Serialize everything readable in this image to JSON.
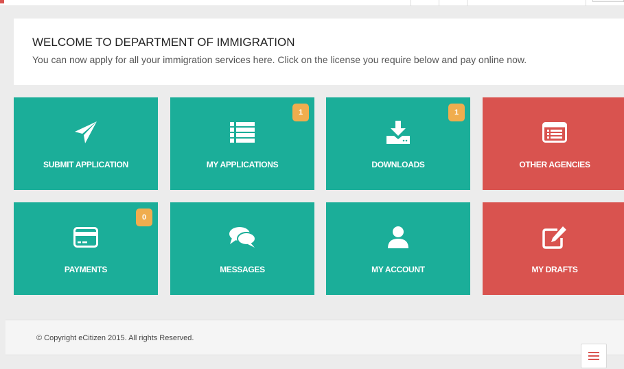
{
  "welcome": {
    "title": "WELCOME TO DEPARTMENT OF IMMIGRATION",
    "subtitle": "You can now apply for all your immigration services here. Click on the license you require below and pay online now."
  },
  "tiles": [
    {
      "label": "SUBMIT APPLICATION",
      "icon": "paper-plane-icon",
      "color": "#1bae99"
    },
    {
      "label": "MY APPLICATIONS",
      "icon": "list-icon",
      "color": "#1bae99",
      "badge": "1"
    },
    {
      "label": "DOWNLOADS",
      "icon": "download-icon",
      "color": "#1bae99",
      "badge": "1"
    },
    {
      "label": "OTHER AGENCIES",
      "icon": "list-alt-icon",
      "color": "#d9534f"
    },
    {
      "label": "PAYMENTS",
      "icon": "credit-card-icon",
      "color": "#1bae99",
      "badge": "0"
    },
    {
      "label": "MESSAGES",
      "icon": "comments-icon",
      "color": "#1bae99"
    },
    {
      "label": "MY ACCOUNT",
      "icon": "user-icon",
      "color": "#1bae99"
    },
    {
      "label": "MY DRAFTS",
      "icon": "edit-icon",
      "color": "#d9534f"
    }
  ],
  "badge_color": "#f0ad4e",
  "footer": {
    "copyright": "© Copyright eCitizen 2015. All rights Reserved."
  },
  "menu_button": {
    "icon": "hamburger-menu-icon"
  }
}
